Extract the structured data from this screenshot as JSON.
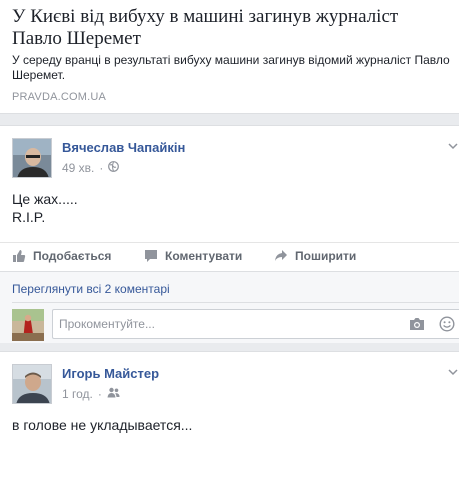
{
  "link_preview": {
    "title": "У Києві від вибуху в машині загинув журналіст Павло Шеремет",
    "description": "У середу вранці в результаті вибуху машини загинув відомий журналіст Павло Шеремет.",
    "source": "PRAVDA.COM.UA"
  },
  "post1": {
    "author": "Вячеслав Чапайкін",
    "time": "49 хв.",
    "separator": "·",
    "privacy_icon": "globe-icon",
    "text_line1": "Це жах.....",
    "text_line2": "R.I.P.",
    "actions": {
      "like": "Подобається",
      "comment": "Коментувати",
      "share": "Поширити"
    },
    "view_comments": "Переглянути всі 2 коментарі",
    "comment_placeholder": "Прокоментуйте..."
  },
  "post2": {
    "author": "Игорь Майстер",
    "time": "1 год.",
    "separator": "·",
    "privacy_icon": "friends-icon",
    "text": "в голове не укладывается..."
  },
  "colors": {
    "link_blue": "#365899",
    "muted_grey": "#90949c",
    "action_grey": "#616770",
    "background": "#e9ebee"
  }
}
